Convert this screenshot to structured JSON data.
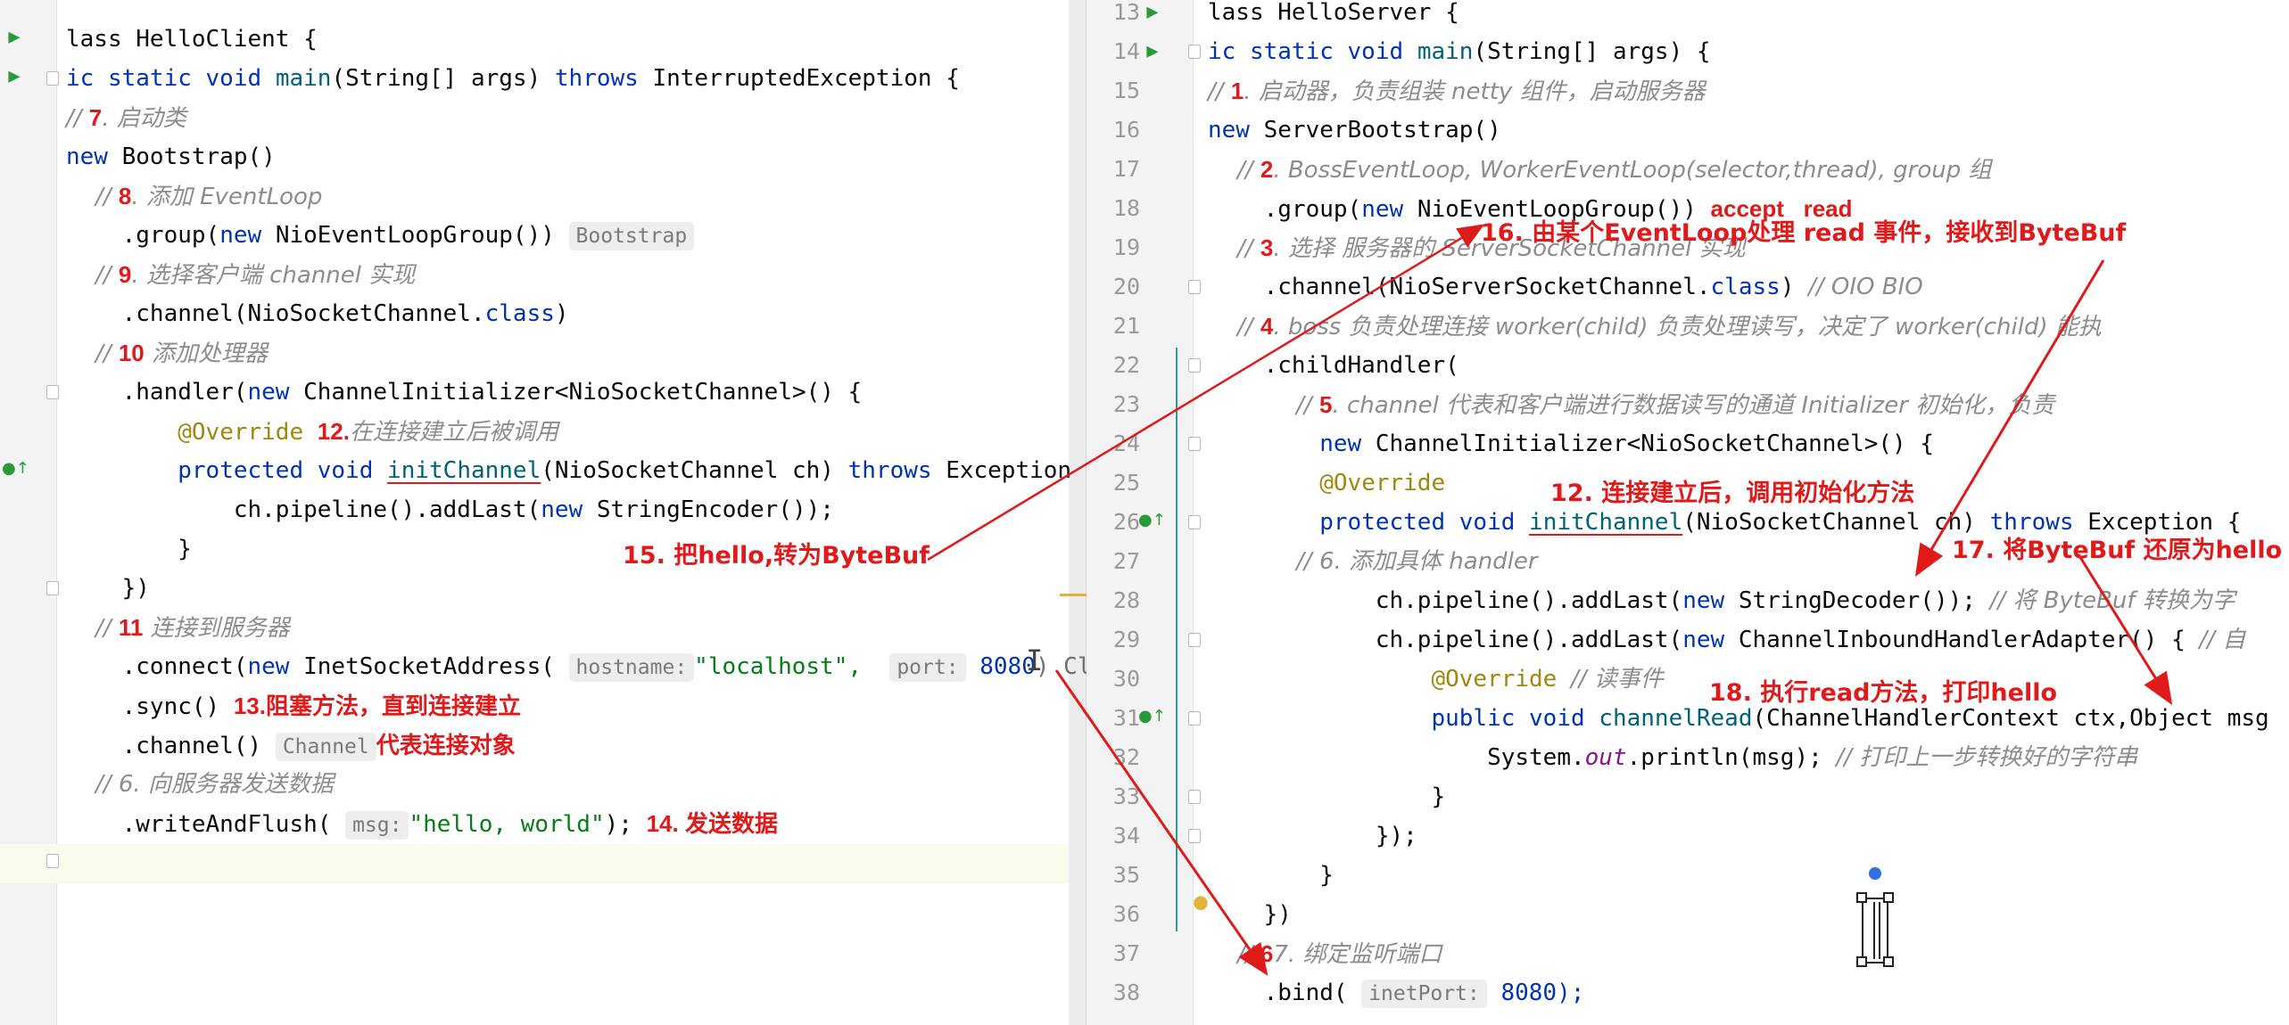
{
  "left": {
    "lines": [
      {
        "id": "l1",
        "tokens": [
          [
            "lass HelloClient {",
            ""
          ]
        ]
      },
      {
        "id": "l2",
        "tokens": [
          [
            "ic static void ",
            "kw"
          ],
          [
            "main",
            "fn"
          ],
          [
            "(String[] args) ",
            ""
          ],
          [
            "throws ",
            "kw"
          ],
          [
            "InterruptedException {",
            ""
          ]
        ]
      },
      {
        "id": "l3",
        "tokens": [
          [
            "// ",
            "cm"
          ],
          [
            "7",
            "num"
          ],
          [
            ". 启动类",
            "cm"
          ]
        ]
      },
      {
        "id": "l4",
        "tokens": [
          [
            "new ",
            "kw"
          ],
          [
            "Bootstrap()",
            ""
          ]
        ]
      },
      {
        "id": "l5",
        "tokens": [
          [
            "    // ",
            "cm"
          ],
          [
            "8",
            "num"
          ],
          [
            ". 添加 EventLoop",
            "cm"
          ]
        ]
      },
      {
        "id": "l6",
        "tokens": [
          [
            "    .group(",
            ""
          ],
          [
            "new ",
            "kw"
          ],
          [
            "NioEventLoopGroup()) ",
            ""
          ]
        ],
        "hint": "Bootstrap"
      },
      {
        "id": "l7",
        "tokens": [
          [
            "    // ",
            "cm"
          ],
          [
            "9",
            "num"
          ],
          [
            ". 选择客户端 channel 实现",
            "cm"
          ]
        ]
      },
      {
        "id": "l8",
        "tokens": [
          [
            "    .channel(NioSocketChannel.",
            ""
          ],
          [
            "class",
            "kw"
          ],
          [
            ")",
            ""
          ]
        ]
      },
      {
        "id": "l9",
        "tokens": [
          [
            "    // ",
            "cm"
          ],
          [
            "10",
            "num"
          ],
          [
            " 添加处理器",
            "cm"
          ]
        ]
      },
      {
        "id": "l10",
        "tokens": [
          [
            "    .handler(",
            ""
          ],
          [
            "new ",
            "kw"
          ],
          [
            "ChannelInitializer<NioSocketChannel>() {",
            ""
          ]
        ]
      },
      {
        "id": "l11",
        "tokens": [
          [
            "        ",
            ""
          ],
          [
            "@Override",
            "ann"
          ],
          [
            " ",
            ""
          ],
          [
            "12.",
            "num"
          ],
          [
            "在连接建立后被调用",
            "cm"
          ]
        ]
      },
      {
        "id": "l12",
        "tokens": [
          [
            "        ",
            ""
          ],
          [
            "protected void ",
            "kw"
          ],
          [
            "initChannel",
            "fn ul"
          ],
          [
            "(NioSocketChannel ch) ",
            ""
          ],
          [
            "throws ",
            "kw"
          ],
          [
            "Exception",
            ""
          ]
        ]
      },
      {
        "id": "l13",
        "tokens": [
          [
            "            ch.pipeline().addLast(",
            ""
          ],
          [
            "new ",
            "kw"
          ],
          [
            "StringEncoder());",
            ""
          ]
        ]
      },
      {
        "id": "l14",
        "tokens": [
          [
            "        }",
            ""
          ]
        ]
      },
      {
        "id": "l15",
        "tokens": [
          [
            "    })",
            ""
          ]
        ]
      },
      {
        "id": "l16",
        "tokens": [
          [
            "    // ",
            "cm"
          ],
          [
            "11",
            "num"
          ],
          [
            " 连接到服务器",
            "cm"
          ]
        ]
      },
      {
        "id": "l17",
        "tokens": [
          [
            "    .connect(",
            ""
          ],
          [
            "new ",
            "kw"
          ],
          [
            "InetSocketAddress( ",
            ""
          ]
        ],
        "hints2": [
          [
            "hostname:",
            "\"localhost\", "
          ],
          [
            "port:",
            "8080"
          ]
        ],
        "tail": ") Cl"
      },
      {
        "id": "l18",
        "tokens": [
          [
            "    .sync() ",
            ""
          ],
          [
            "13.阻塞方法，直到连接建立",
            "num"
          ]
        ]
      },
      {
        "id": "l19",
        "tokens": [
          [
            "    .channel() ",
            ""
          ]
        ],
        "hint": "Channel",
        "after": "代表连接对象"
      },
      {
        "id": "l20",
        "tokens": [
          [
            "    // 6. 向服务器发送数据",
            "cm"
          ]
        ]
      },
      {
        "id": "l21",
        "tokens": [
          [
            "    .writeAndFlush( ",
            ""
          ]
        ],
        "hintA": "msg:",
        "strA": "\"hello, world\"",
        "rest": "); ",
        "note": "14. 发送数据"
      }
    ]
  },
  "right": {
    "line_numbers": [
      "13",
      "14",
      "15",
      "16",
      "17",
      "18",
      "19",
      "20",
      "21",
      "22",
      "23",
      "24",
      "25",
      "26",
      "27",
      "28",
      "29",
      "30",
      "31",
      "32",
      "33",
      "34",
      "35",
      "36",
      "37",
      "38"
    ],
    "lines": [
      {
        "id": "r13",
        "tokens": [
          [
            "lass HelloServer {",
            ""
          ]
        ]
      },
      {
        "id": "r14",
        "tokens": [
          [
            "ic static void ",
            "kw"
          ],
          [
            "main",
            "fn"
          ],
          [
            "(String[] args) {",
            ""
          ]
        ]
      },
      {
        "id": "r15",
        "tokens": [
          [
            "// ",
            "cm"
          ],
          [
            "1",
            "num"
          ],
          [
            ". 启动器，负责组装 netty 组件，启动服务器",
            "cm"
          ]
        ]
      },
      {
        "id": "r16",
        "tokens": [
          [
            "new ",
            "kw"
          ],
          [
            "ServerBootstrap()",
            ""
          ]
        ]
      },
      {
        "id": "r17",
        "tokens": [
          [
            "    // ",
            "cm"
          ],
          [
            "2",
            "num"
          ],
          [
            ". BossEventLoop, WorkerEventLoop(selector,thread), group 组",
            "cm"
          ]
        ]
      },
      {
        "id": "r18",
        "tokens": [
          [
            "    .group(",
            ""
          ],
          [
            "new ",
            "kw"
          ],
          [
            "NioEventLoopGroup()) ",
            ""
          ],
          [
            "accept   read",
            "num"
          ]
        ]
      },
      {
        "id": "r19",
        "tokens": [
          [
            "    // ",
            "cm"
          ],
          [
            "3",
            "num"
          ],
          [
            ". 选择 服务器的 ServerSocketChannel 实现",
            "cm"
          ]
        ]
      },
      {
        "id": "r20",
        "tokens": [
          [
            "    .channel(NioServerSocketChannel.",
            ""
          ],
          [
            "class",
            "kw"
          ],
          [
            ") ",
            ""
          ],
          [
            "// OIO BIO",
            "cm"
          ]
        ]
      },
      {
        "id": "r21",
        "tokens": [
          [
            "    // ",
            "cm"
          ],
          [
            "4",
            "num"
          ],
          [
            ". boss 负责处理连接 worker(child) 负责处理读写，决定了 worker(child) 能执",
            "cm"
          ]
        ]
      },
      {
        "id": "r22",
        "tokens": [
          [
            "    .childHandler(",
            ""
          ]
        ]
      },
      {
        "id": "r23",
        "tokens": [
          [
            "            // ",
            "cm"
          ],
          [
            "5",
            "num"
          ],
          [
            ". channel 代表和客户端进行数据读写的通道 Initializer 初始化，负责",
            "cm"
          ]
        ]
      },
      {
        "id": "r24",
        "tokens": [
          [
            "        ",
            ""
          ],
          [
            "new ",
            "kw"
          ],
          [
            "ChannelInitializer<NioSocketChannel>() {",
            ""
          ]
        ]
      },
      {
        "id": "r25",
        "tokens": [
          [
            "        ",
            ""
          ],
          [
            "@Override",
            "ann"
          ]
        ]
      },
      {
        "id": "r26",
        "tokens": [
          [
            "        ",
            ""
          ],
          [
            "protected void ",
            "kw"
          ],
          [
            "initChannel",
            "fn ul"
          ],
          [
            "(NioSocketChannel ch) ",
            ""
          ],
          [
            "throws ",
            "kw"
          ],
          [
            "Exception {",
            ""
          ]
        ]
      },
      {
        "id": "r27",
        "tokens": [
          [
            "            // 6. 添加具体 handler",
            "cm"
          ]
        ]
      },
      {
        "id": "r28",
        "tokens": [
          [
            "            ch.pipeline().addLast(",
            ""
          ],
          [
            "new ",
            "kw"
          ],
          [
            "StringDecoder()); ",
            ""
          ],
          [
            "// 将 ByteBuf 转换为字",
            "cm"
          ]
        ]
      },
      {
        "id": "r29",
        "tokens": [
          [
            "            ch.pipeline().addLast(",
            ""
          ],
          [
            "new ",
            "kw"
          ],
          [
            "ChannelInboundHandlerAdapter() { ",
            ""
          ],
          [
            "// 自",
            "cm"
          ]
        ]
      },
      {
        "id": "r30",
        "tokens": [
          [
            "                ",
            ""
          ],
          [
            "@Override",
            "ann"
          ],
          [
            " ",
            ""
          ],
          [
            "// 读事件",
            "cm"
          ]
        ]
      },
      {
        "id": "r31",
        "tokens": [
          [
            "                ",
            ""
          ],
          [
            "public void ",
            "kw"
          ],
          [
            "channelRead",
            "fn"
          ],
          [
            "(ChannelHandlerContext ctx,Object msg",
            ""
          ]
        ]
      },
      {
        "id": "r32",
        "tokens": [
          [
            "                    System.",
            ""
          ],
          [
            "out",
            "stat"
          ],
          [
            ".println(msg); ",
            ""
          ],
          [
            "// 打印上一步转换好的字符串",
            "cm"
          ]
        ]
      },
      {
        "id": "r33",
        "tokens": [
          [
            "                }",
            ""
          ]
        ]
      },
      {
        "id": "r34",
        "tokens": [
          [
            "            });",
            ""
          ]
        ]
      },
      {
        "id": "r35",
        "tokens": [
          [
            "        }",
            ""
          ]
        ]
      },
      {
        "id": "r36",
        "tokens": [
          [
            "    })",
            ""
          ]
        ]
      },
      {
        "id": "r37",
        "tokens": [
          [
            "    // ",
            "cm"
          ],
          [
            "6",
            "num"
          ],
          [
            "7. 绑定监听端口",
            "cm"
          ]
        ]
      },
      {
        "id": "r38",
        "tokens": [
          [
            "    .bind( ",
            ""
          ]
        ],
        "hint": "inetPort:",
        "tail": " 8080);"
      }
    ]
  },
  "notes": {
    "n15": "15. 把hello,转为ByteBuf",
    "n16": "16. 由某个EventLoop处理 read 事件，接收到ByteBuf",
    "n12": "12. 连接建立后，调用初始化方法",
    "n17": "17. 将ByteBuf 还原为hello",
    "n18": "18. 执行read方法，打印hello"
  },
  "colors": {
    "annotation_red": "#e01a1a",
    "keyword": "#0033b3",
    "method": "#00627a",
    "string": "#067d17",
    "comment": "#8c8c8c"
  }
}
